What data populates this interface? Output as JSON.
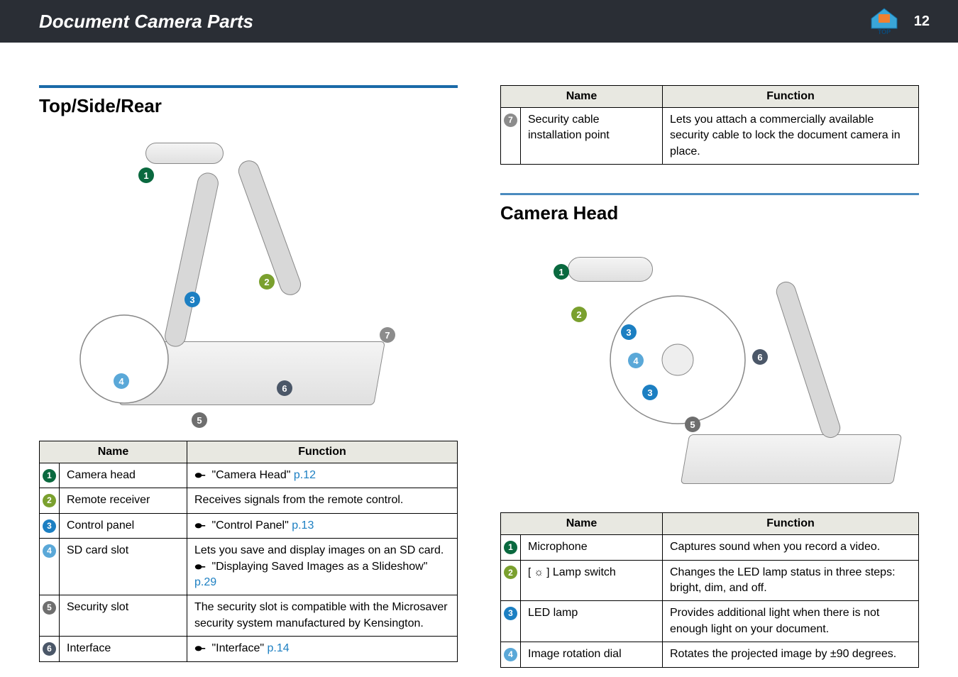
{
  "header": {
    "title": "Document Camera Parts",
    "page_number": "12"
  },
  "left": {
    "section_title": "Top/Side/Rear",
    "table": {
      "col_name": "Name",
      "col_function": "Function",
      "rows": [
        {
          "num": "1",
          "cls": "c1",
          "name": "Camera head",
          "func_link_prefix": "\"Camera Head\"",
          "func_link_page": " p.12",
          "func_text": ""
        },
        {
          "num": "2",
          "cls": "c2",
          "name": "Remote receiver",
          "func_text": "Receives signals from the remote control."
        },
        {
          "num": "3",
          "cls": "c3",
          "name": "Control panel",
          "func_link_prefix": "\"Control Panel\"",
          "func_link_page": " p.13",
          "func_text": ""
        },
        {
          "num": "4",
          "cls": "c4",
          "name": "SD card slot",
          "func_text": "Lets you save and display images on an SD card.",
          "func_link_prefix": "\"Displaying Saved Images as a Slideshow\"",
          "func_link_page": " p.29"
        },
        {
          "num": "5",
          "cls": "c5",
          "name": "Security slot",
          "func_text": "The security slot is compatible with the Microsaver security system manufactured by Kensington."
        },
        {
          "num": "6",
          "cls": "c6",
          "name": "Interface",
          "func_link_prefix": "\"Interface\"",
          "func_link_page": " p.14",
          "func_text": ""
        }
      ]
    }
  },
  "right_top": {
    "table": {
      "col_name": "Name",
      "col_function": "Function",
      "rows": [
        {
          "num": "7",
          "cls": "c7",
          "name": "Security cable installation point",
          "func_text": "Lets you attach a commercially available security cable to lock the document camera in place."
        }
      ]
    }
  },
  "right": {
    "section_title": "Camera  Head",
    "table": {
      "col_name": "Name",
      "col_function": "Function",
      "rows": [
        {
          "num": "1",
          "cls": "c1",
          "name": "Microphone",
          "func_text": "Captures sound when you record a video."
        },
        {
          "num": "2",
          "cls": "c2",
          "name": "[☼] Lamp switch",
          "name_has_icon": true,
          "func_text": "Changes the LED lamp status in three steps: bright, dim, and off."
        },
        {
          "num": "3",
          "cls": "c3",
          "name": "LED lamp",
          "func_text": "Provides additional light when there is not enough light on your document."
        },
        {
          "num": "4",
          "cls": "c4",
          "name": "Image rotation dial",
          "func_text": "Rotates the projected image by ±90 degrees."
        }
      ]
    }
  }
}
